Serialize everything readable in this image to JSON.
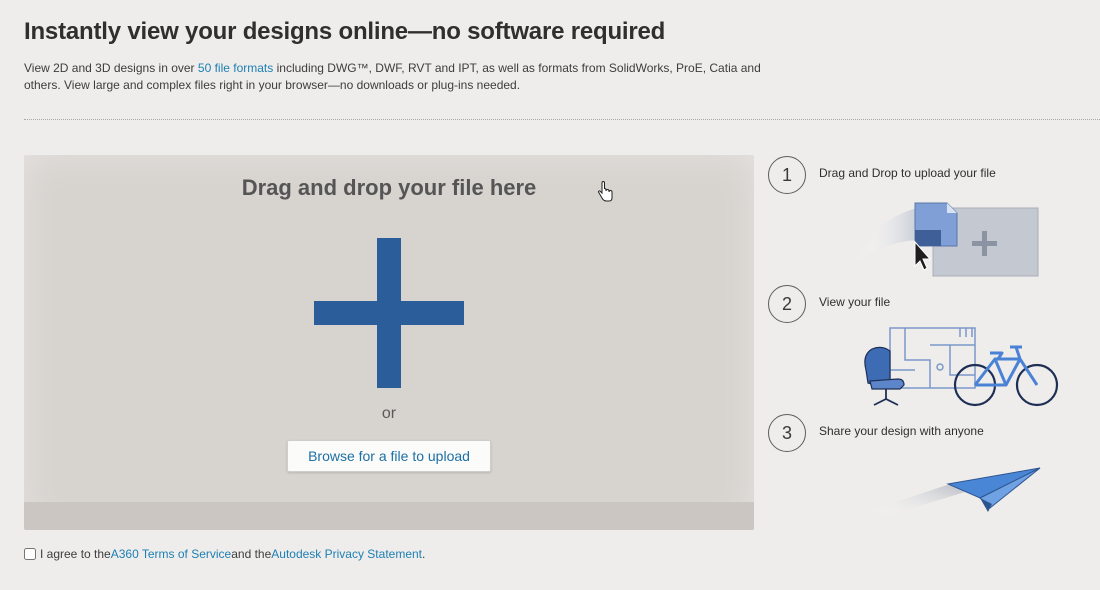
{
  "header": {
    "title": "Instantly view your designs online—no software required",
    "intro_prefix": "View 2D and 3D designs in over ",
    "intro_link": "50 file formats",
    "intro_suffix": " including DWG™, DWF, RVT and IPT, as well as formats from SolidWorks, ProE, Catia and others. View large and complex files right in your browser—no downloads or plug-ins needed."
  },
  "dropzone": {
    "title": "Drag and drop your file here",
    "or_label": "or",
    "browse_label": "Browse for a file to upload"
  },
  "terms": {
    "prefix": "I agree to the ",
    "tos_link": "A360 Terms of Service",
    "middle": " and the ",
    "privacy_link": "Autodesk Privacy Statement",
    "suffix": ".",
    "checked": false
  },
  "steps": [
    {
      "number": "1",
      "label": "Drag and Drop to upload your file"
    },
    {
      "number": "2",
      "label": "View your file"
    },
    {
      "number": "3",
      "label": "Share your design with anyone"
    }
  ],
  "colors": {
    "accent_blue": "#2b5d9b",
    "link_blue": "#1d7fb3"
  }
}
